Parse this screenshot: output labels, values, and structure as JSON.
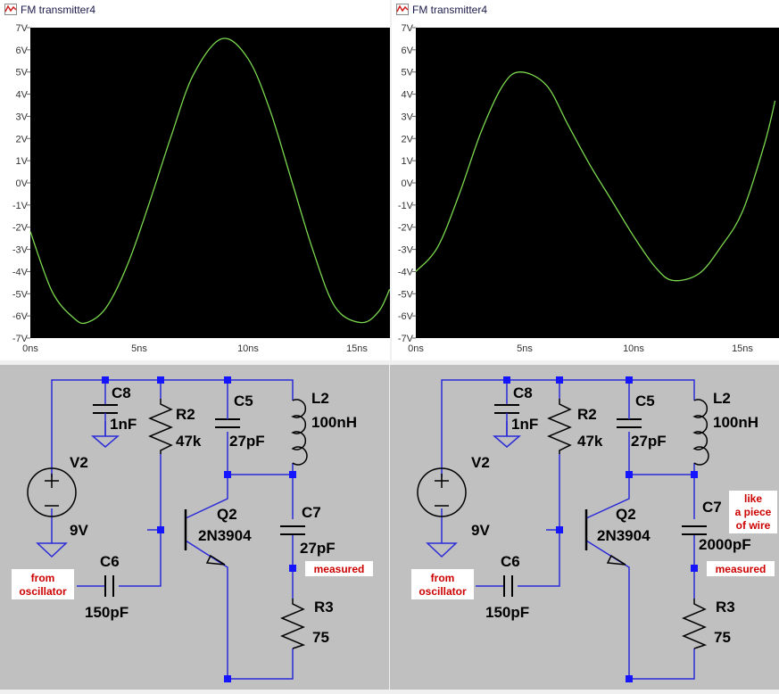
{
  "colors": {
    "plot_bg": "#000000",
    "trace": "#7bd84e",
    "axis_text": "#d9d9d9",
    "schematic_bg": "#c0c0c0",
    "wire": "#2a2ad8",
    "node": "#1515ff",
    "note_text": "#cc0000"
  },
  "left_window": {
    "title": "FM transmitter4",
    "y_ticks": [
      "7V",
      "6V",
      "5V",
      "4V",
      "3V",
      "2V",
      "1V",
      "0V",
      "-1V",
      "-2V",
      "-3V",
      "-4V",
      "-5V",
      "-6V",
      "-7V"
    ],
    "x_ticks": [
      "0ns",
      "5ns",
      "10ns",
      "15ns"
    ]
  },
  "right_window": {
    "title": "FM transmitter4",
    "y_ticks": [
      "7V",
      "6V",
      "5V",
      "4V",
      "3V",
      "2V",
      "1V",
      "0V",
      "-1V",
      "-2V",
      "-3V",
      "-4V",
      "-5V",
      "-6V",
      "-7V"
    ],
    "x_ticks": [
      "0ns",
      "5ns",
      "10ns",
      "15ns"
    ]
  },
  "left_schematic": {
    "c8_name": "C8",
    "c8_value": "1nF",
    "r2_name": "R2",
    "r2_value": "47k",
    "c5_name": "C5",
    "c5_value": "27pF",
    "l2_name": "L2",
    "l2_value": "100nH",
    "v2_name": "V2",
    "v2_value": "9V",
    "q2_name": "Q2",
    "q2_value": "2N3904",
    "c7_name": "C7",
    "c7_value": "27pF",
    "c6_name": "C6",
    "c6_value": "150pF",
    "r3_name": "R3",
    "r3_value": "75",
    "from_line1": "from",
    "from_line2": "oscillator",
    "measured": "measured"
  },
  "right_schematic": {
    "c8_name": "C8",
    "c8_value": "1nF",
    "r2_name": "R2",
    "r2_value": "47k",
    "c5_name": "C5",
    "c5_value": "27pF",
    "l2_name": "L2",
    "l2_value": "100nH",
    "v2_name": "V2",
    "v2_value": "9V",
    "q2_name": "Q2",
    "q2_value": "2N3904",
    "c7_name": "C7",
    "c7_value": "2000pF",
    "c6_name": "C6",
    "c6_value": "150pF",
    "r3_name": "R3",
    "r3_value": "75",
    "from_line1": "from",
    "from_line2": "oscillator",
    "measured": "measured",
    "note_line1": "like",
    "note_line2": "a piece",
    "note_line3": "of wire"
  },
  "chart_data": [
    {
      "type": "line",
      "title": "FM transmitter4",
      "xlabel": "",
      "ylabel": "",
      "xlim": [
        0,
        16.5
      ],
      "ylim": [
        -7,
        7
      ],
      "x_ticks": [
        "0ns",
        "5ns",
        "10ns",
        "15ns"
      ],
      "grid": false,
      "series": [
        {
          "x": [
            0,
            1,
            2,
            2.6,
            3.5,
            4.5,
            5.5,
            6.5,
            7.5,
            8.8,
            10,
            11,
            12,
            13,
            14,
            15.2,
            16,
            16.5
          ],
          "values": [
            -2.2,
            -4.9,
            -6.1,
            -6.3,
            -5.6,
            -3.6,
            -0.8,
            2.2,
            4.9,
            6.5,
            5.6,
            3.3,
            0.1,
            -3.1,
            -5.6,
            -6.3,
            -5.8,
            -4.8
          ]
        }
      ]
    },
    {
      "type": "line",
      "title": "FM transmitter4",
      "xlabel": "",
      "ylabel": "",
      "xlim": [
        0,
        16.5
      ],
      "ylim": [
        -7,
        7
      ],
      "x_ticks": [
        "0ns",
        "5ns",
        "10ns",
        "15ns"
      ],
      "grid": false,
      "series": [
        {
          "x": [
            0,
            1,
            2,
            3,
            4,
            4.8,
            6,
            7,
            8,
            9,
            10,
            11,
            11.8,
            13,
            14,
            15,
            16,
            16.5
          ],
          "values": [
            -4,
            -2.9,
            -0.5,
            2.3,
            4.4,
            5,
            4.4,
            2.6,
            0.8,
            -0.8,
            -2.4,
            -3.8,
            -4.4,
            -4.1,
            -2.9,
            -1.3,
            1.7,
            3.7
          ]
        }
      ]
    }
  ]
}
